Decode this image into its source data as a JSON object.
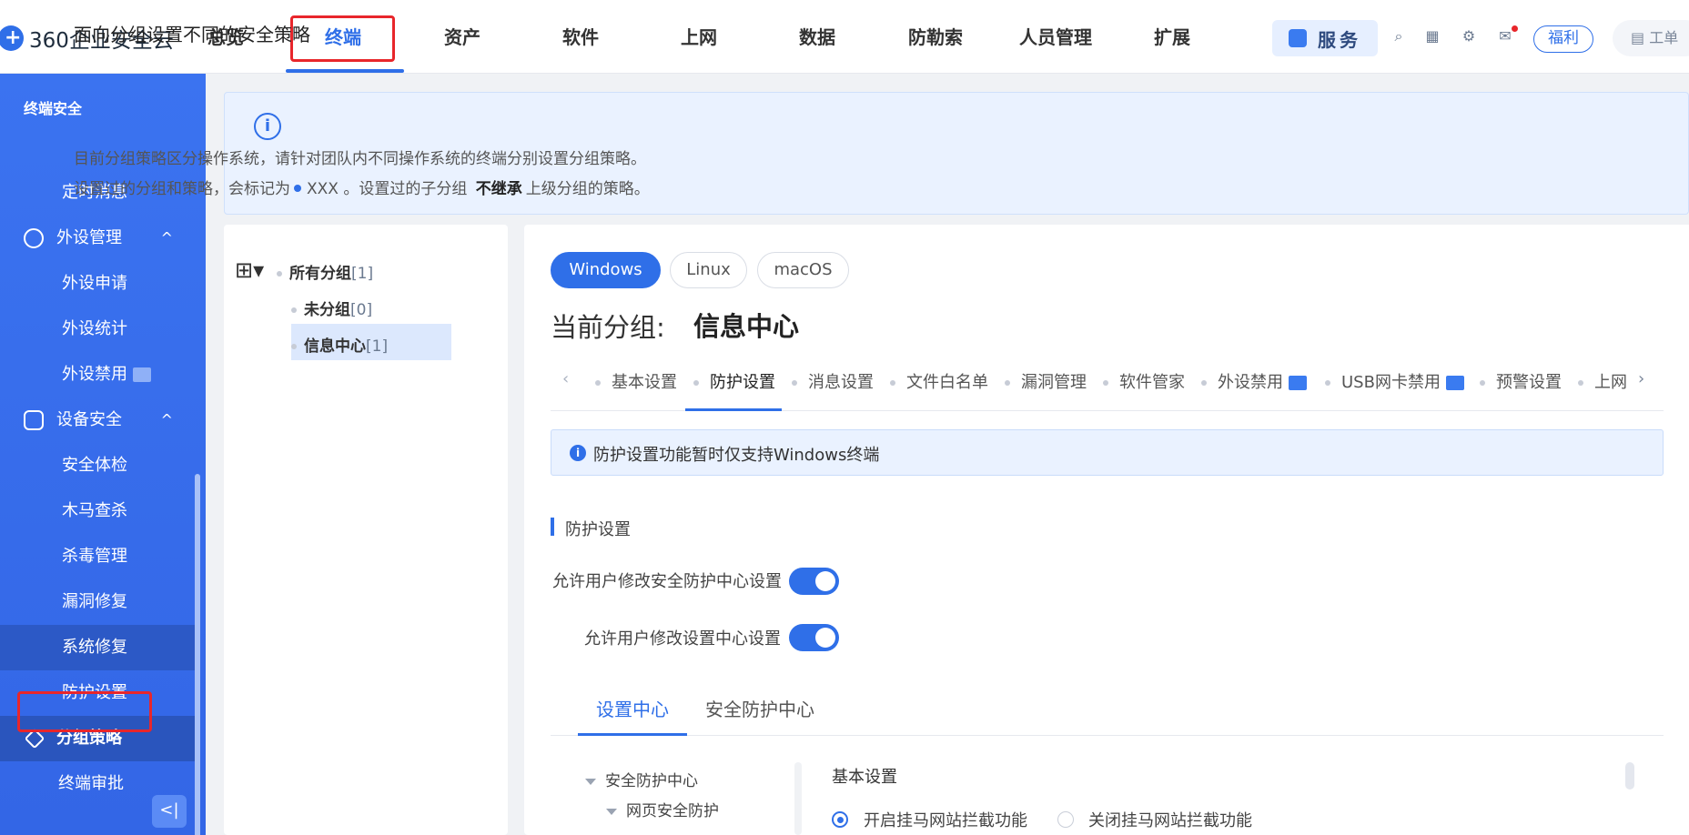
{
  "brand": {
    "name": "360企业安全云"
  },
  "nav": {
    "items": [
      "总览",
      "终端",
      "资产",
      "软件",
      "上网",
      "数据",
      "防勒索",
      "人员管理",
      "扩展"
    ],
    "active": "终端",
    "service_label": "服务",
    "welfare_label": "福利",
    "ticket_label": "工单"
  },
  "sidebar": {
    "title": "终端安全",
    "items": [
      {
        "label": "定时消息",
        "type": "sub"
      },
      {
        "label": "外设管理",
        "type": "group",
        "icon": "peripheral-icon"
      },
      {
        "label": "外设申请",
        "type": "sub"
      },
      {
        "label": "外设统计",
        "type": "sub"
      },
      {
        "label": "外设禁用",
        "type": "sub"
      },
      {
        "label": "设备安全",
        "type": "group",
        "icon": "shield-icon"
      },
      {
        "label": "安全体检",
        "type": "sub"
      },
      {
        "label": "木马查杀",
        "type": "sub"
      },
      {
        "label": "杀毒管理",
        "type": "sub"
      },
      {
        "label": "漏洞修复",
        "type": "sub"
      },
      {
        "label": "系统修复",
        "type": "sub"
      },
      {
        "label": "防护设置",
        "type": "sub"
      },
      {
        "label": "分组策略",
        "type": "active",
        "icon": "layers-icon"
      },
      {
        "label": "终端审批",
        "type": "sub"
      }
    ],
    "collapse_label": "<|"
  },
  "notice": {
    "title": "面向分组设置不同的安全策略",
    "line1": "目前分组策略区分操作系统，请针对团队内不同操作系统的终端分别设置分组策略。",
    "line2_a": "设置过的分组和策略，会标记为",
    "line2_b": "XXX 。设置过的子分组",
    "line2_strong": "不继承",
    "line2_c": "上级分组的策略。"
  },
  "tree": {
    "root": {
      "label": "所有分组",
      "count": "[1]"
    },
    "children": [
      {
        "label": "未分组",
        "count": "[0]"
      },
      {
        "label": "信息中心",
        "count": "[1]",
        "selected": true
      }
    ]
  },
  "main": {
    "os_tabs": [
      "Windows",
      "Linux",
      "macOS"
    ],
    "os_active": "Windows",
    "current_group_label": "当前分组:",
    "current_group": "信息中心",
    "sub_tabs": [
      "基本设置",
      "防护设置",
      "消息设置",
      "文件白名单",
      "漏洞管理",
      "软件管家",
      "外设禁用",
      "USB网卡禁用",
      "预警设置",
      "上网"
    ],
    "sub_active": "防护设置",
    "info_text": "防护设置功能暂时仅支持Windows终端",
    "section_title": "防护设置",
    "switches": [
      {
        "label": "允许用户修改安全防护中心设置",
        "on": true
      },
      {
        "label": "允许用户修改设置中心设置",
        "on": true
      }
    ],
    "bottom_tabs": [
      "设置中心",
      "安全防护中心"
    ],
    "bottom_active": "设置中心",
    "left_tree": [
      "安全防护中心",
      "网页安全防护"
    ],
    "basic_title": "基本设置",
    "radios": [
      {
        "label": "开启挂马网站拦截功能",
        "checked": true
      },
      {
        "label": "关闭挂马网站拦截功能",
        "checked": false
      }
    ]
  },
  "colors": {
    "accent": "#2f6fe8",
    "sidebar": "#3b73f0",
    "highlight": "#e8262b"
  }
}
